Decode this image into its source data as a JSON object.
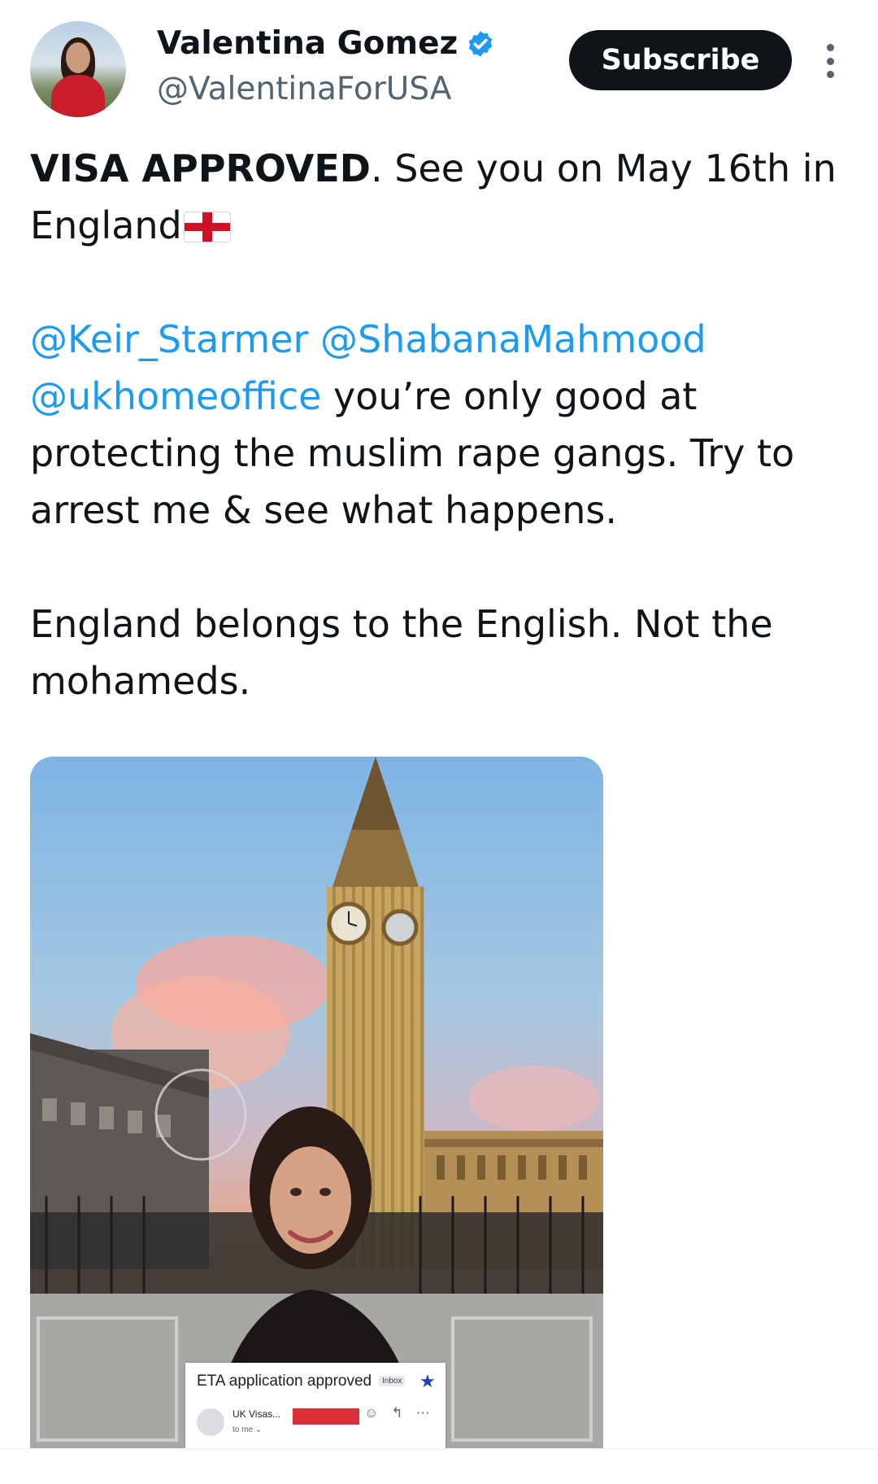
{
  "author": {
    "name": "Valentina Gomez",
    "handle": "@ValentinaForUSA",
    "verified": true
  },
  "actions": {
    "subscribe_label": "Subscribe",
    "more_icon": "more-vertical-icon"
  },
  "tweet": {
    "line1_bold": "VISA APPROVED",
    "line1_rest": ". See you on May 16th in England",
    "flag_icon": "england-flag-emoji",
    "mention1": "@Keir_Starmer",
    "mention2": "@ShabanaMahmood",
    "mention3": "@ukhomeoffice",
    "para2_rest": " you’re only good at protecting the muslim rape gangs. Try to arrest me & see what happens.",
    "para3": "England belongs to the English. Not the mohameds."
  },
  "media": {
    "email": {
      "subject": "ETA application approved",
      "tag": "Inbox",
      "sender": "UK Visas...",
      "to": "to me ⌄",
      "star_icon": "star-icon",
      "reply_icon": "reply-icon",
      "emoji_icon": "emoji-icon",
      "more_icon": "more-horizontal-icon"
    }
  },
  "colors": {
    "mention": "#1d9bf0",
    "text": "#0f1419",
    "secondary": "#536471",
    "subscribe_bg": "#0f1419"
  }
}
